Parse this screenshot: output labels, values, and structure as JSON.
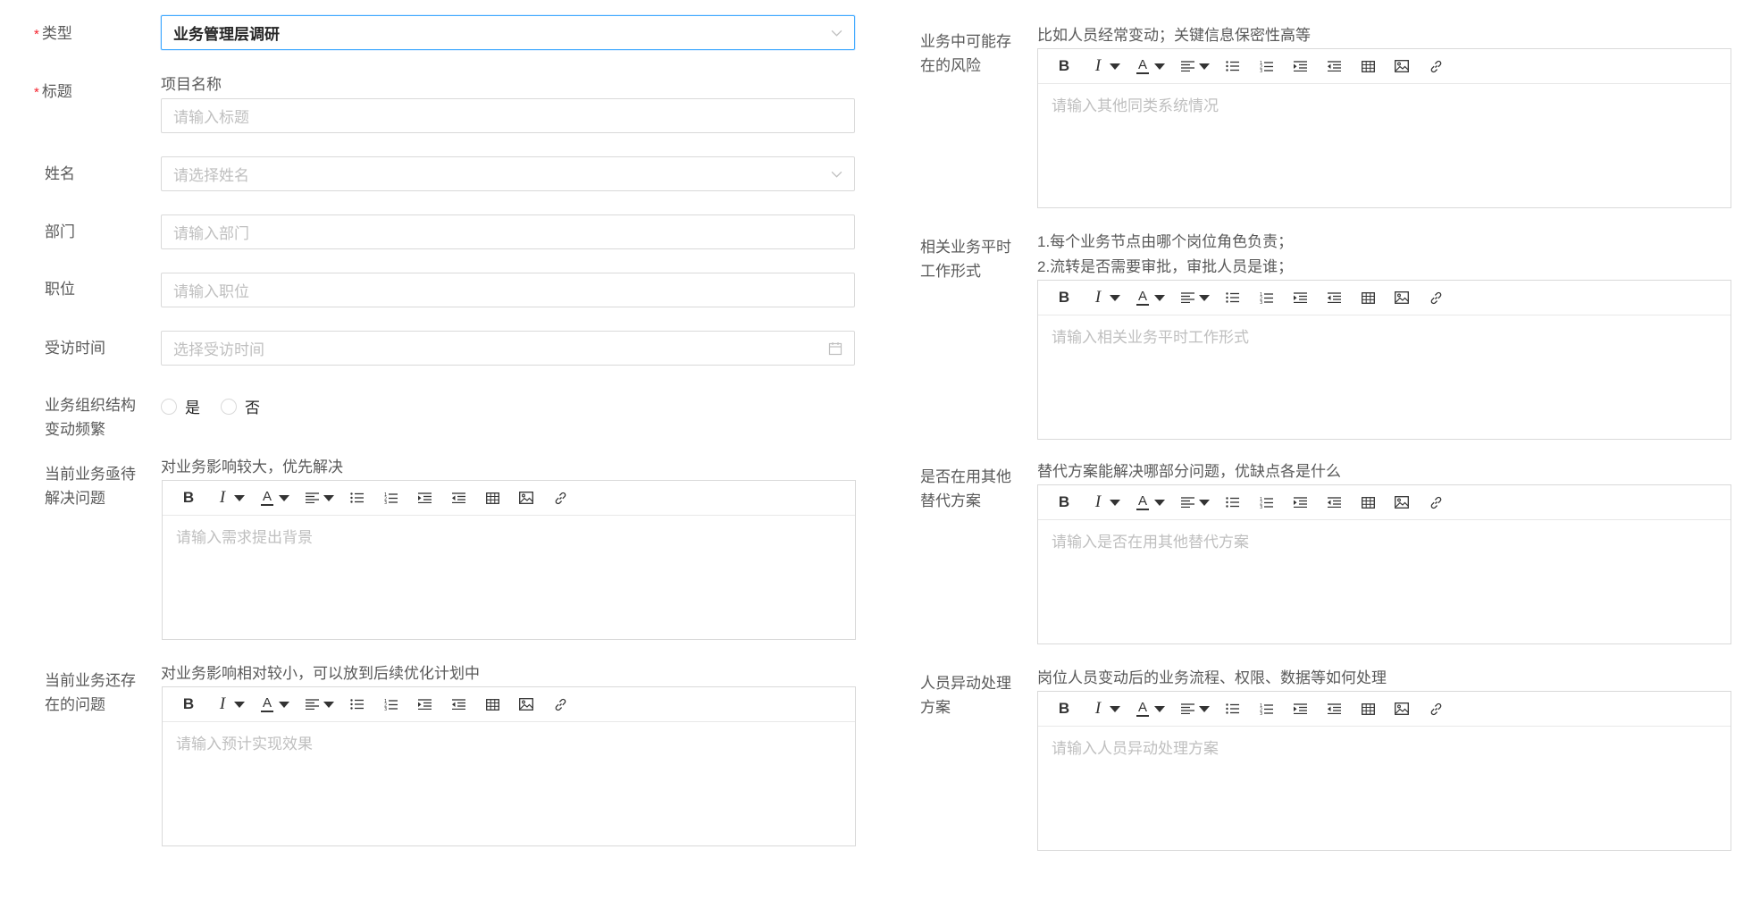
{
  "left": {
    "type": {
      "label": "类型",
      "value": "业务管理层调研"
    },
    "title": {
      "label": "标题",
      "hint": "项目名称",
      "placeholder": "请输入标题"
    },
    "name": {
      "label": "姓名",
      "placeholder": "请选择姓名"
    },
    "dept": {
      "label": "部门",
      "placeholder": "请输入部门"
    },
    "position": {
      "label": "职位",
      "placeholder": "请输入职位"
    },
    "visit_time": {
      "label": "受访时间",
      "placeholder": "选择受访时间"
    },
    "org_change": {
      "label_line1": "业务组织结构",
      "label_line2": "变动频繁",
      "options": [
        "是",
        "否"
      ]
    },
    "urgent_problem": {
      "label_line1": "当前业务亟待",
      "label_line2": "解决问题",
      "hint": "对业务影响较大，优先解决",
      "placeholder": "请输入需求提出背景"
    },
    "existing_problem": {
      "label_line1": "当前业务还存",
      "label_line2": "在的问题",
      "hint": "对业务影响相对较小，可以放到后续优化计划中",
      "placeholder": "请输入预计实现效果"
    }
  },
  "right": {
    "risk": {
      "label_line1": "业务中可能存",
      "label_line2": "在的风险",
      "hint": "比如人员经常变动；关键信息保密性高等",
      "placeholder": "请输入其他同类系统情况"
    },
    "work_form": {
      "label_line1": "相关业务平时",
      "label_line2": "工作形式",
      "hint_line1": "1.每个业务节点由哪个岗位角色负责；",
      "hint_line2": "2.流转是否需要审批，审批人员是谁；",
      "placeholder": "请输入相关业务平时工作形式"
    },
    "alternative": {
      "label_line1": "是否在用其他",
      "label_line2": "替代方案",
      "hint": "替代方案能解决哪部分问题，优缺点各是什么",
      "placeholder": "请输入是否在用其他替代方案"
    },
    "personnel": {
      "label_line1": "人员异动处理",
      "label_line2": "方案",
      "hint": "岗位人员变动后的业务流程、权限、数据等如何处理",
      "placeholder": "请输入人员异动处理方案"
    }
  },
  "toolbar": {
    "bold": "B",
    "italic": "I",
    "font_color": "A"
  },
  "required_mark": "*",
  "colors": {
    "required": "#f5222d",
    "focus_border": "#40a9ff",
    "placeholder": "#bfbfbf",
    "border": "#d9d9d9"
  }
}
